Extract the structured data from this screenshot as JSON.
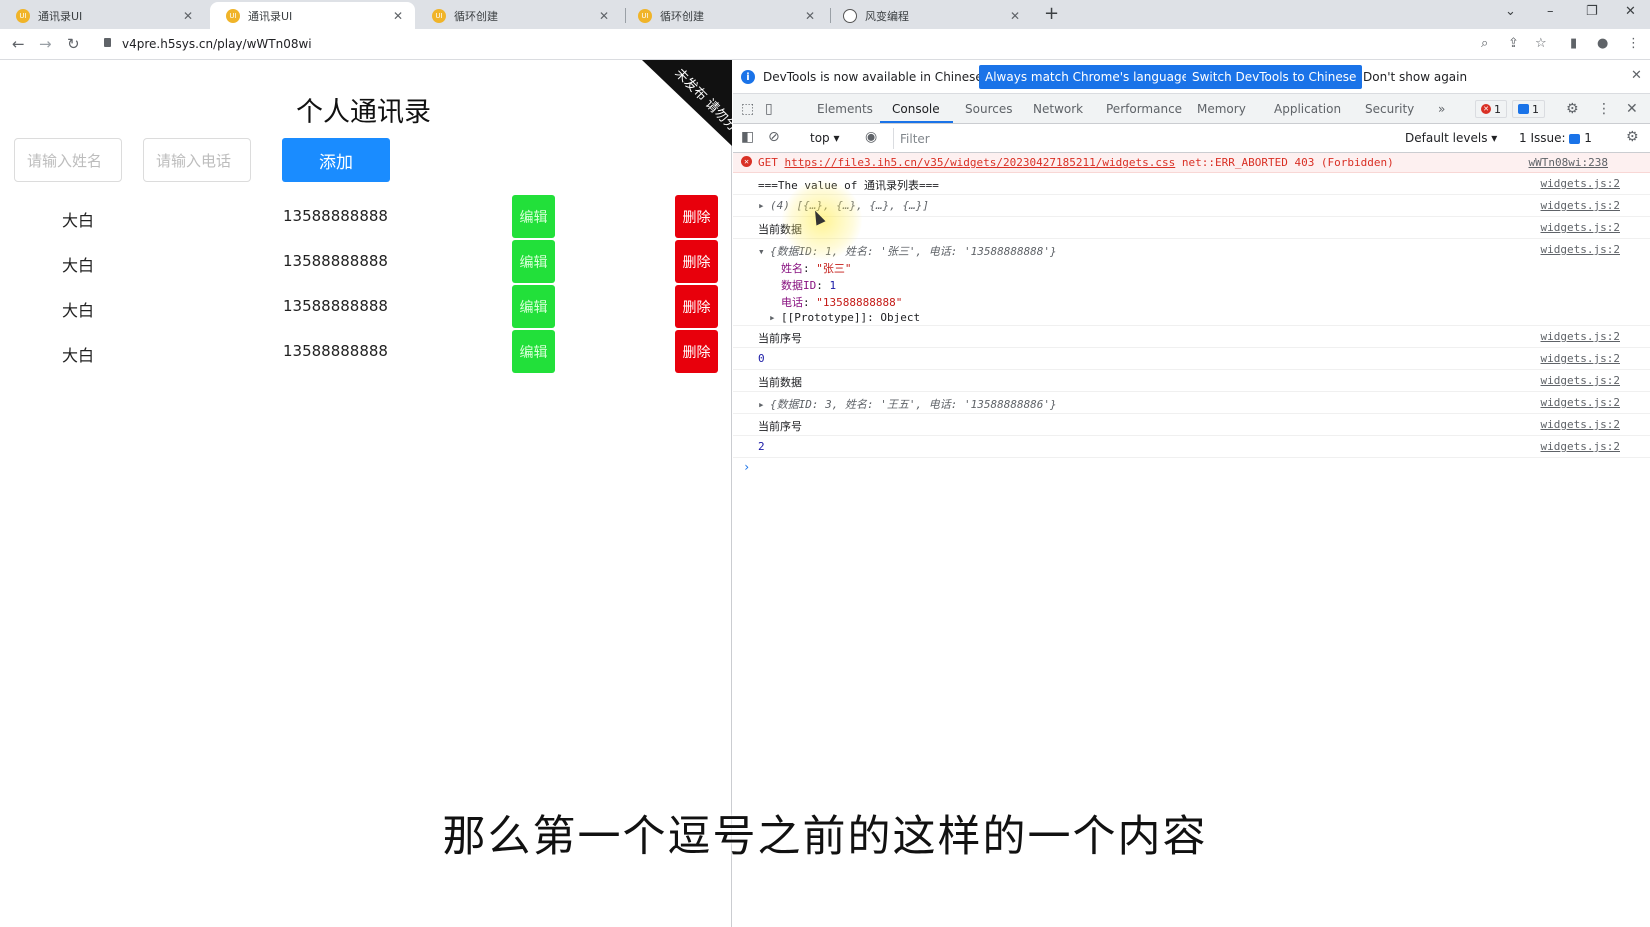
{
  "browser": {
    "tabs": [
      {
        "title": "通讯录UI",
        "active": false
      },
      {
        "title": "通讯录UI",
        "active": true
      },
      {
        "title": "循环创建",
        "active": false
      },
      {
        "title": "循环创建",
        "active": false
      },
      {
        "title": "风变编程",
        "active": false
      }
    ],
    "url": "v4pre.h5sys.cn/play/wWTn08wi"
  },
  "app": {
    "title": "个人通讯录",
    "name_placeholder": "请输入姓名",
    "phone_placeholder": "请输入电话",
    "add_label": "添加",
    "ribbon": "未发布 请勿分享",
    "rows": [
      {
        "name": "大白",
        "phone": "13588888888",
        "edit": "编辑",
        "delete": "删除"
      },
      {
        "name": "大白",
        "phone": "13588888888",
        "edit": "编辑",
        "delete": "删除"
      },
      {
        "name": "大白",
        "phone": "13588888888",
        "edit": "编辑",
        "delete": "删除"
      },
      {
        "name": "大白",
        "phone": "13588888888",
        "edit": "编辑",
        "delete": "删除"
      }
    ]
  },
  "devtools": {
    "infobar": {
      "text": "DevTools is now available in Chinese!",
      "btn_match": "Always match Chrome's language",
      "btn_switch": "Switch DevTools to Chinese",
      "dismiss": "Don't show again"
    },
    "tabs": [
      "Elements",
      "Console",
      "Sources",
      "Network",
      "Performance",
      "Memory",
      "Application",
      "Security"
    ],
    "more_tabs": "»",
    "error_count": "1",
    "message_count": "1",
    "context": "top",
    "filter_placeholder": "Filter",
    "levels": "Default levels",
    "issues": "1 Issue:",
    "issues_count": "1",
    "console": {
      "error_line": {
        "method": "GET",
        "url": "https://file3.ih5.cn/v35/widgets/20230427185211/widgets.css",
        "status": "net::ERR_ABORTED 403 (Forbidden)",
        "src": "wWTn08wi:238"
      },
      "line1": "===The value of 通讯录列表===",
      "line2": "(4) [{…}, {…}, {…}, {…}]",
      "line3": "当前数据",
      "obj1": "{数据ID: 1, 姓名: '张三', 电话: '13588888888'}",
      "obj1_name_key": "姓名",
      "obj1_name_val": "\"张三\"",
      "obj1_id_key": "数据ID",
      "obj1_id_val": "1",
      "obj1_phone_key": "电话",
      "obj1_phone_val": "\"13588888888\"",
      "obj1_proto": "[[Prototype]]: Object",
      "line4": "当前序号",
      "line5": "0",
      "line6": "当前数据",
      "obj2": "{数据ID: 3, 姓名: '王五', 电话: '13588888886'}",
      "line7": "当前序号",
      "line8": "2",
      "src": "widgets.js:2"
    }
  },
  "subtitle": "那么第一个逗号之前的这样的一个内容"
}
